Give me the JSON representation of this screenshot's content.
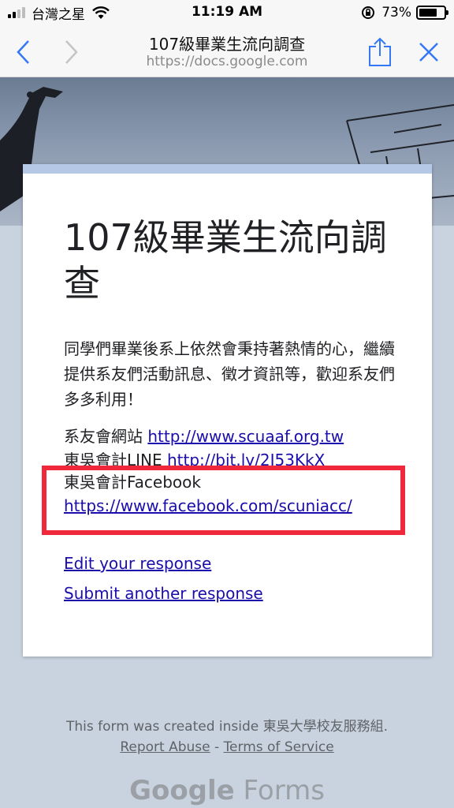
{
  "status_bar": {
    "carrier": "台灣之星",
    "time": "11:19 AM",
    "battery_pct": "73%",
    "battery_level": 0.73
  },
  "nav": {
    "title": "107級畢業生流向調查",
    "url": "https://docs.google.com"
  },
  "form": {
    "title": "107級畢業生流向調查",
    "description": "同學們畢業後系上依然會秉持著熱情的心，繼續提供系友們活動訊息、徵才資訊等，歡迎系友們多多利用！",
    "links": [
      {
        "label": "系友會網站 ",
        "url": "http://www.scuaaf.org.tw"
      },
      {
        "label": "東吳會計LINE ",
        "url": "http://bit.ly/2I53KkX"
      },
      {
        "label": "東吳會計Facebook",
        "url": "https://www.facebook.com/scuniacc/"
      }
    ],
    "edit_response": "Edit your response",
    "submit_another": "Submit another response"
  },
  "footer": {
    "created_text": "This form was created inside 東吳大學校友服務組.",
    "report_abuse": "Report Abuse",
    "separator": " - ",
    "terms": "Terms of Service",
    "brand_google": "Google",
    "brand_forms": " Forms"
  },
  "colors": {
    "link": "#1a0dab",
    "highlight": "#f0283c",
    "card_accent": "#b5c9e6",
    "page_bg": "#c9d3e0"
  }
}
